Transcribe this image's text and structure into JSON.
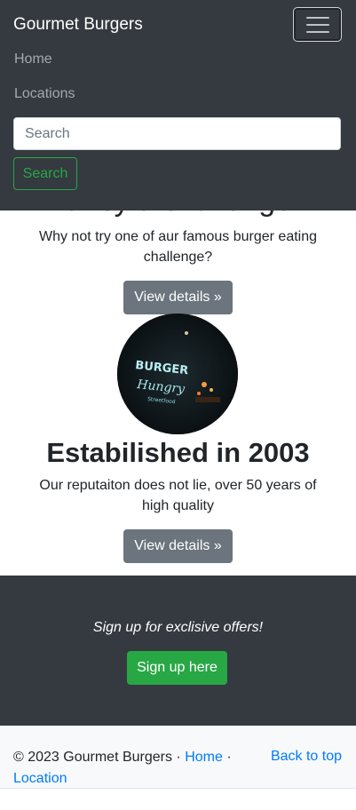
{
  "navbar": {
    "brand": "Gourmet Burgers",
    "toggler_icon": "hamburger-menu-icon",
    "links": [
      "Home",
      "Locations"
    ],
    "search_placeholder": "Search",
    "search_button": "Search"
  },
  "features": [
    {
      "title": "Fancy a challenge?",
      "text": "Why not try one of aur famous burger eating challenge?",
      "button": "View details »"
    },
    {
      "image": "burger-hungry-neon-sign-photo",
      "title": "Estabilished in 2003",
      "text": "Our reputaiton does not lie, over 50 years of high quality",
      "button": "View details »"
    }
  ],
  "signup": {
    "text": "Sign up for exclisive offers!",
    "button": "Sign up here"
  },
  "footer": {
    "copyright": "© 2023 Gourmet Burgers ·",
    "home_link": "Home",
    "separator": "·",
    "location_link": "Location",
    "back_to_top": "Back to top"
  },
  "colors": {
    "navbar_bg": "#343a40",
    "success": "#28a745",
    "secondary": "#6c757d",
    "link": "#007bff",
    "footer_bg": "#f8f9fa"
  }
}
